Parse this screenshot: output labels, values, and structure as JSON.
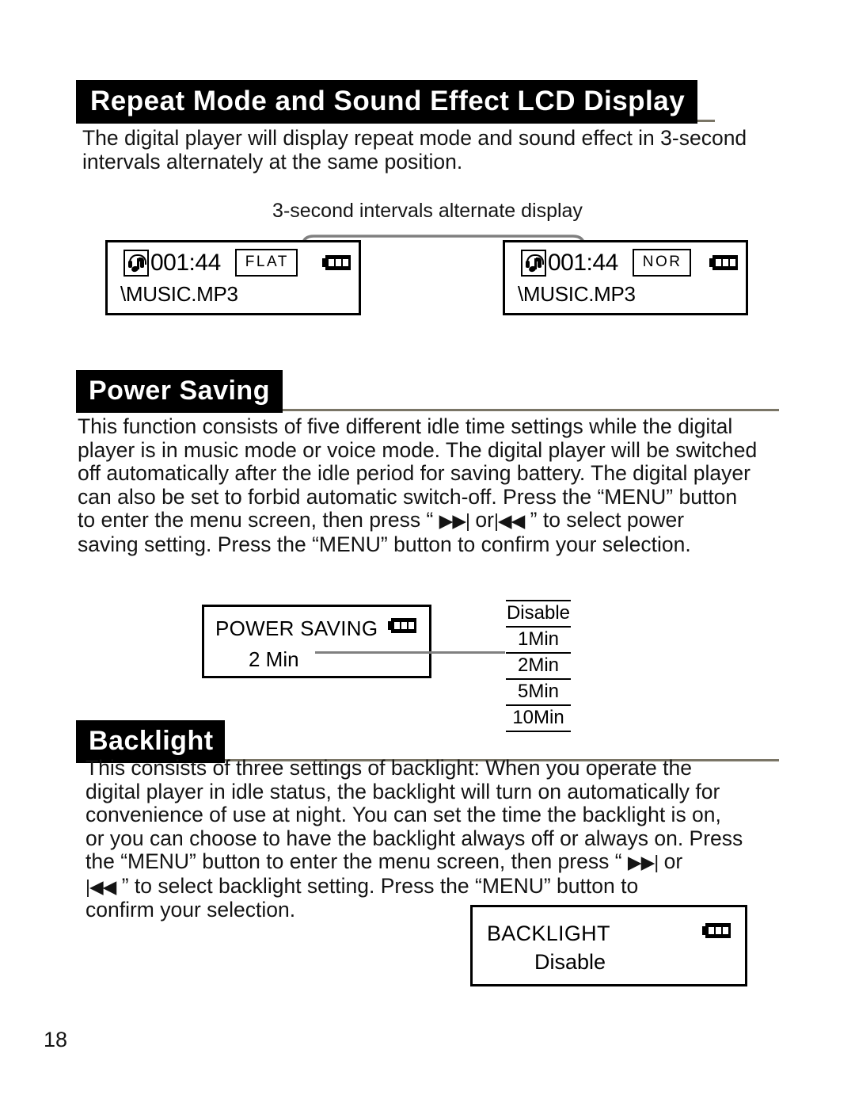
{
  "page": {
    "number": "18"
  },
  "sections": {
    "repeat_mode": {
      "heading": "Repeat Mode and Sound Effect LCD Display",
      "body": "The digital player will display repeat mode and sound effect in 3-second\n intervals alternately at the same position.",
      "caption": "3-second intervals alternate display",
      "lcd_left": {
        "icon": "music-headphone-icon",
        "time": "001:44",
        "mode": "FLAT",
        "battery": "battery-full-icon",
        "file": "\\MUSIC.MP3"
      },
      "lcd_right": {
        "icon": "music-headphone-icon",
        "time": "001:44",
        "mode": "NOR",
        "battery": "battery-full-icon",
        "file": "\\MUSIC.MP3"
      }
    },
    "power_saving": {
      "heading": "Power Saving",
      "body_part1": "This function consists of five different idle time settings while the digital\nplayer is in music mode or voice mode. The digital player will be switched\noff automatically after the idle period for saving battery. The digital player\ncan also be set to forbid automatic switch-off. Press the “MENU” button\nto enter the menu screen, then press “ ",
      "next_glyph": "▶▶|",
      "body_part2": " or",
      "prev_glyph": "|◀◀",
      "body_part3": " ” to select power\nsaving setting. Press the “MENU” button to confirm your selection.",
      "screen": {
        "title": "POWER SAVING",
        "value": "2  Min",
        "battery": "battery-full-icon"
      },
      "options": [
        "Disable",
        "1Min",
        "2Min",
        "5Min",
        "10Min"
      ]
    },
    "backlight": {
      "heading": "Backlight",
      "body_part1": "This consists of three settings of backlight: When you operate the\ndigital player in idle status, the backlight will turn on automatically for\nconvenience of use at night. You can set the time the backlight is on,\nor you can choose to have the backlight always off or always on. Press\nthe “MENU” button to enter the menu screen, then press “ ",
      "next_glyph": "▶▶|",
      "body_part2": " or\n ",
      "prev_glyph": "|◀◀",
      "body_part3": " ” to select backlight setting. Press the “MENU” button to\nconfirm your selection.",
      "screen": {
        "title": "BACKLIGHT",
        "value": "Disable",
        "battery": "battery-full-icon"
      }
    }
  },
  "colors": {
    "banner_bg": "#000000",
    "banner_text": "#ffffff",
    "rule": "#7a7566",
    "connector": "#808080"
  }
}
